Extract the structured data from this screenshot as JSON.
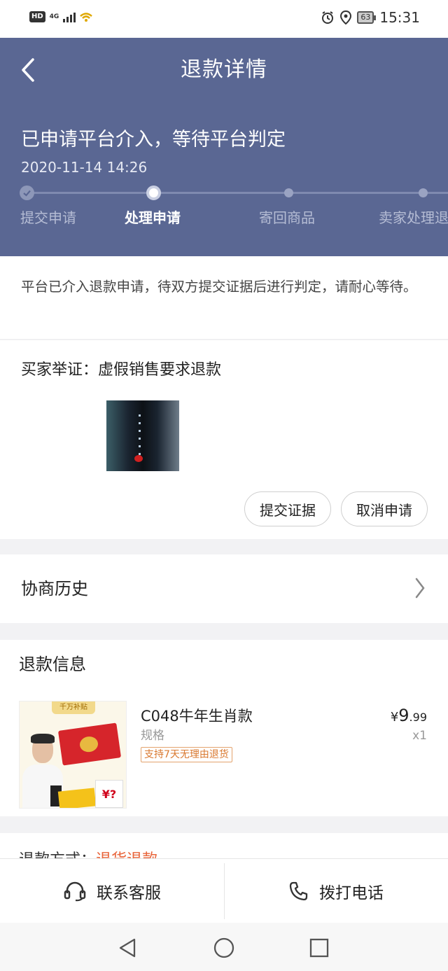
{
  "status_bar": {
    "hd": "HD",
    "network": "4G",
    "battery": "63",
    "time": "15:31"
  },
  "header": {
    "title": "退款详情",
    "status_title": "已申请平台介入，等待平台判定",
    "status_time": "2020-11-14 14:26",
    "steps": [
      {
        "label": "提交申请",
        "state": "done"
      },
      {
        "label": "处理申请",
        "state": "current"
      },
      {
        "label": "寄回商品",
        "state": "pending"
      },
      {
        "label": "卖家处理退",
        "state": "pending"
      }
    ]
  },
  "notice": {
    "text": "平台已介入退款申请，待双方提交证据后进行判定，请耐心等待。"
  },
  "evidence": {
    "title": "买家举证：虚假销售要求退款",
    "submit_label": "提交证据",
    "cancel_label": "取消申请"
  },
  "history": {
    "label": "协商历史"
  },
  "refund_info": {
    "title": "退款信息",
    "product": {
      "name": "C048牛年生肖款",
      "spec": "规格",
      "badge": "支持7天无理由退货",
      "price_symbol": "¥",
      "price_int": "9",
      "price_dec": ".99",
      "quantity": "x1",
      "thumb_tag": "千万补贴",
      "thumb_price": "¥?"
    }
  },
  "partial": {
    "label": "退款方式：",
    "value": "退货退款"
  },
  "bottom_bar": {
    "service_label": "联系客服",
    "call_label": "拨打电话"
  },
  "colors": {
    "header_bg": "#5a6793",
    "accent_orange": "#e8643a"
  },
  "icons": [
    "back-icon",
    "check-icon",
    "chevron-right-icon",
    "headset-icon",
    "phone-icon",
    "nav-back-icon",
    "nav-home-icon",
    "nav-recent-icon",
    "alarm-icon",
    "location-icon"
  ]
}
